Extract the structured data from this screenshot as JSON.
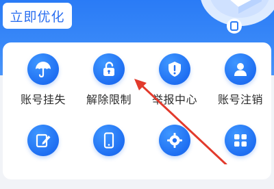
{
  "header": {
    "optimize_label": "立即优化"
  },
  "menu": {
    "items": [
      {
        "label": "账号挂失",
        "icon": "umbrella-icon"
      },
      {
        "label": "解除限制",
        "icon": "unlock-icon"
      },
      {
        "label": "举报中心",
        "icon": "shield-alert-icon"
      },
      {
        "label": "账号注销",
        "icon": "user-icon"
      }
    ],
    "row2_icons": [
      "edit-note-icon",
      "phone-icon",
      "gear-icon",
      "apps-grid-icon"
    ]
  },
  "colors": {
    "primary_blue": "#2a7bf6",
    "icon_blue": "#1f6ff2",
    "annotation_red": "#e23a2c"
  }
}
